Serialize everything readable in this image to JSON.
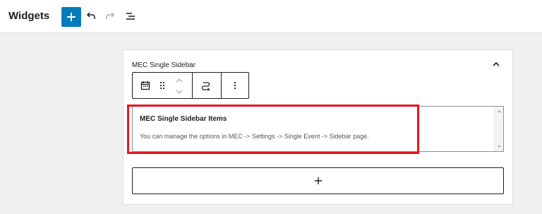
{
  "header": {
    "title": "Widgets",
    "add_icon": "plus-icon",
    "undo_icon": "undo-icon",
    "redo_icon": "redo-icon",
    "list_view_icon": "list-view-icon"
  },
  "widget_area": {
    "title": "MEC Single Sidebar",
    "collapse_icon": "chevron-up-icon",
    "block_toolbar": {
      "icons": [
        "calendar-icon",
        "drag-handle-icon",
        "chevron-up-icon",
        "chevron-down-icon",
        "transform-icon",
        "more-options-icon"
      ]
    },
    "widget": {
      "title": "MEC Single Sidebar Items",
      "description": "You can manage the options in MEC -> Settings -> Single Event -> Sidebar page."
    },
    "add_block_icon": "plus-icon"
  },
  "colors": {
    "accent": "#007cba",
    "highlight": "#e8141c",
    "background": "#f0f0f1"
  }
}
